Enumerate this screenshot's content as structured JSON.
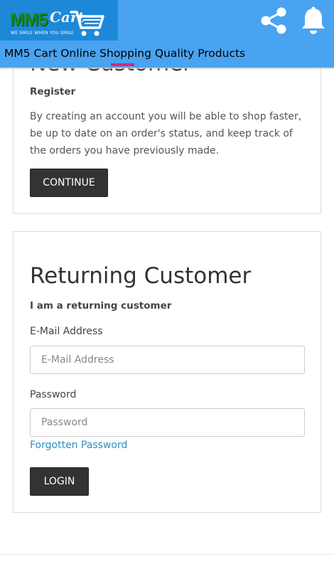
{
  "header": {
    "logo_main": "MM5",
    "logo_script": "Cart",
    "logo_tagline": "WE SMILE WHEN YOU SMILE",
    "title": "MM5 Cart Online Shopping Quality Products",
    "icons": [
      "cart-icon",
      "share-icon",
      "bell-icon"
    ],
    "colors": {
      "appbar": "#4aa3f0",
      "logo_bg": "#1e88d8",
      "tab_indicator": "#e6226a"
    }
  },
  "new_customer": {
    "heading": "New Customer",
    "subheading": "Register",
    "description": "By creating an account you will be able to shop faster, be up to date on an order's status, and keep track of the orders you have previously made.",
    "continue_label": "CONTINUE"
  },
  "returning_customer": {
    "heading": "Returning Customer",
    "subheading": "I am a returning customer",
    "email_label": "E-Mail Address",
    "email_placeholder": "E-Mail Address",
    "email_value": "",
    "password_label": "Password",
    "password_placeholder": "Password",
    "password_value": "",
    "forgotten_label": "Forgotten Password",
    "login_label": "LOGIN"
  }
}
